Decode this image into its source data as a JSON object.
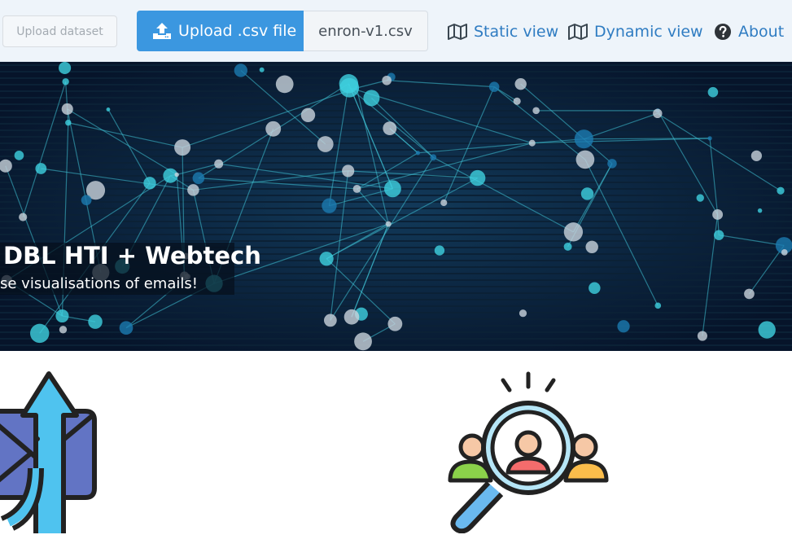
{
  "navbar": {
    "upload_dataset_label": "Upload dataset",
    "upload_csv_label": "Upload .csv file",
    "file_name": "enron-v1.csv",
    "links": [
      {
        "label": "Static view",
        "icon": "map-icon"
      },
      {
        "label": "Dynamic view",
        "icon": "map-icon"
      },
      {
        "label": "About",
        "icon": "question-circle-icon"
      }
    ]
  },
  "hero": {
    "title": "DBL HTI + Webtech",
    "subtitle": "se visualisations of emails!"
  },
  "colors": {
    "primary": "#3b97e0",
    "link": "#2f7cc2",
    "navbar_bg": "#eef4fa",
    "hero_bg": "#08192c",
    "network_line": "#3fc3d6"
  },
  "illustrations": [
    {
      "icon": "mail-upload-icon"
    },
    {
      "icon": "people-search-icon"
    }
  ]
}
